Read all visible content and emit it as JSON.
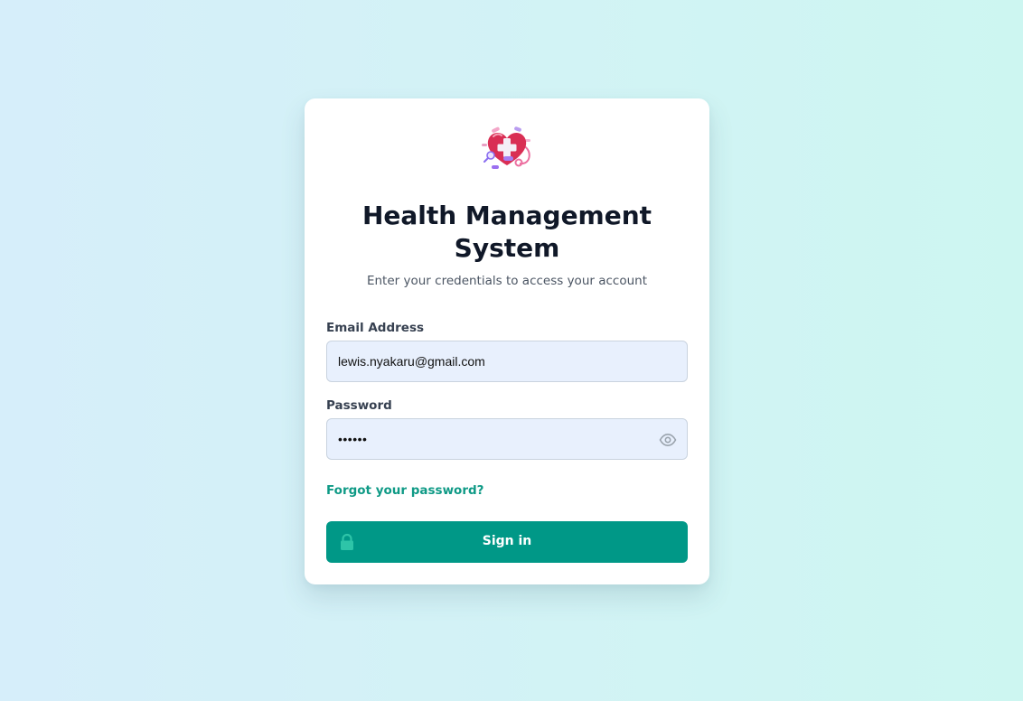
{
  "app": {
    "title": "Health Management System",
    "subtitle": "Enter your credentials to access your account",
    "logo_icon": "heart-medical-icon"
  },
  "form": {
    "email_label": "Email Address",
    "email_value": "lewis.nyakaru@gmail.com",
    "password_label": "Password",
    "password_value": "••••••",
    "password_toggle_icon": "eye-icon",
    "forgot_link": "Forgot your password?",
    "submit_label": "Sign in",
    "submit_icon": "lock-icon"
  },
  "colors": {
    "accent": "#009887",
    "link": "#0f9a86",
    "input_background": "#e8f0fd",
    "title_text": "#101828"
  }
}
